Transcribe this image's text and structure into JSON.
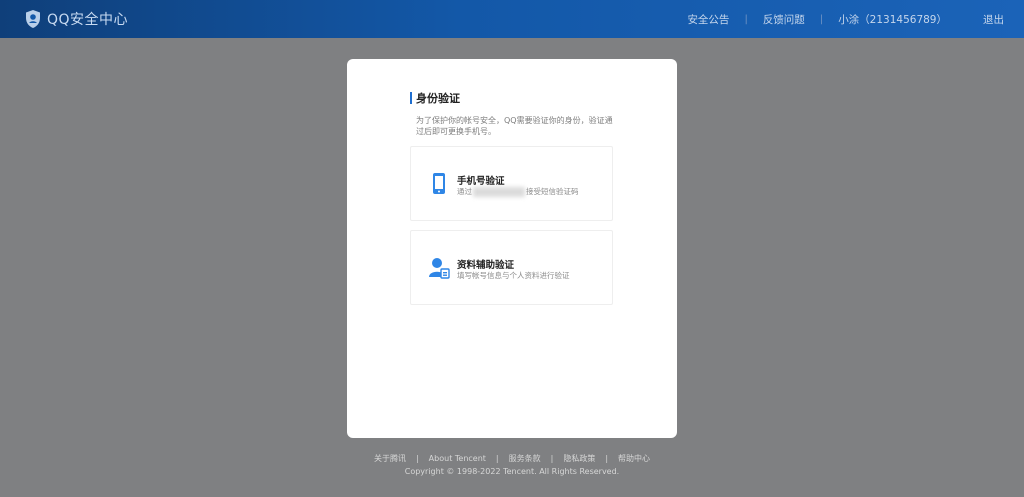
{
  "header": {
    "brand": "QQ安全中心",
    "nav": [
      "安全公告",
      "反馈问题",
      "小涂（2131456789）"
    ],
    "logout": "退出"
  },
  "card": {
    "title": "身份验证",
    "description": "为了保护你的帐号安全，QQ需要验证你的身份，验证通过后即可更换手机号。",
    "options": [
      {
        "title": "手机号验证",
        "sub_prefix": "通过",
        "sub_suffix": "接受短信验证码",
        "icon": "phone-icon"
      },
      {
        "title": "资料辅助验证",
        "sub": "填写帐号信息与个人资料进行验证",
        "icon": "user-card-icon"
      }
    ]
  },
  "footer": {
    "links": [
      "关于腾讯",
      "About Tencent",
      "服务条款",
      "隐私政策",
      "帮助中心"
    ],
    "copyright": "Copyright © 1998-2022 Tencent. All Rights Reserved."
  },
  "colors": {
    "accent": "#1f6fd0",
    "header": "#1358a8",
    "overlay": "#7f8082"
  }
}
